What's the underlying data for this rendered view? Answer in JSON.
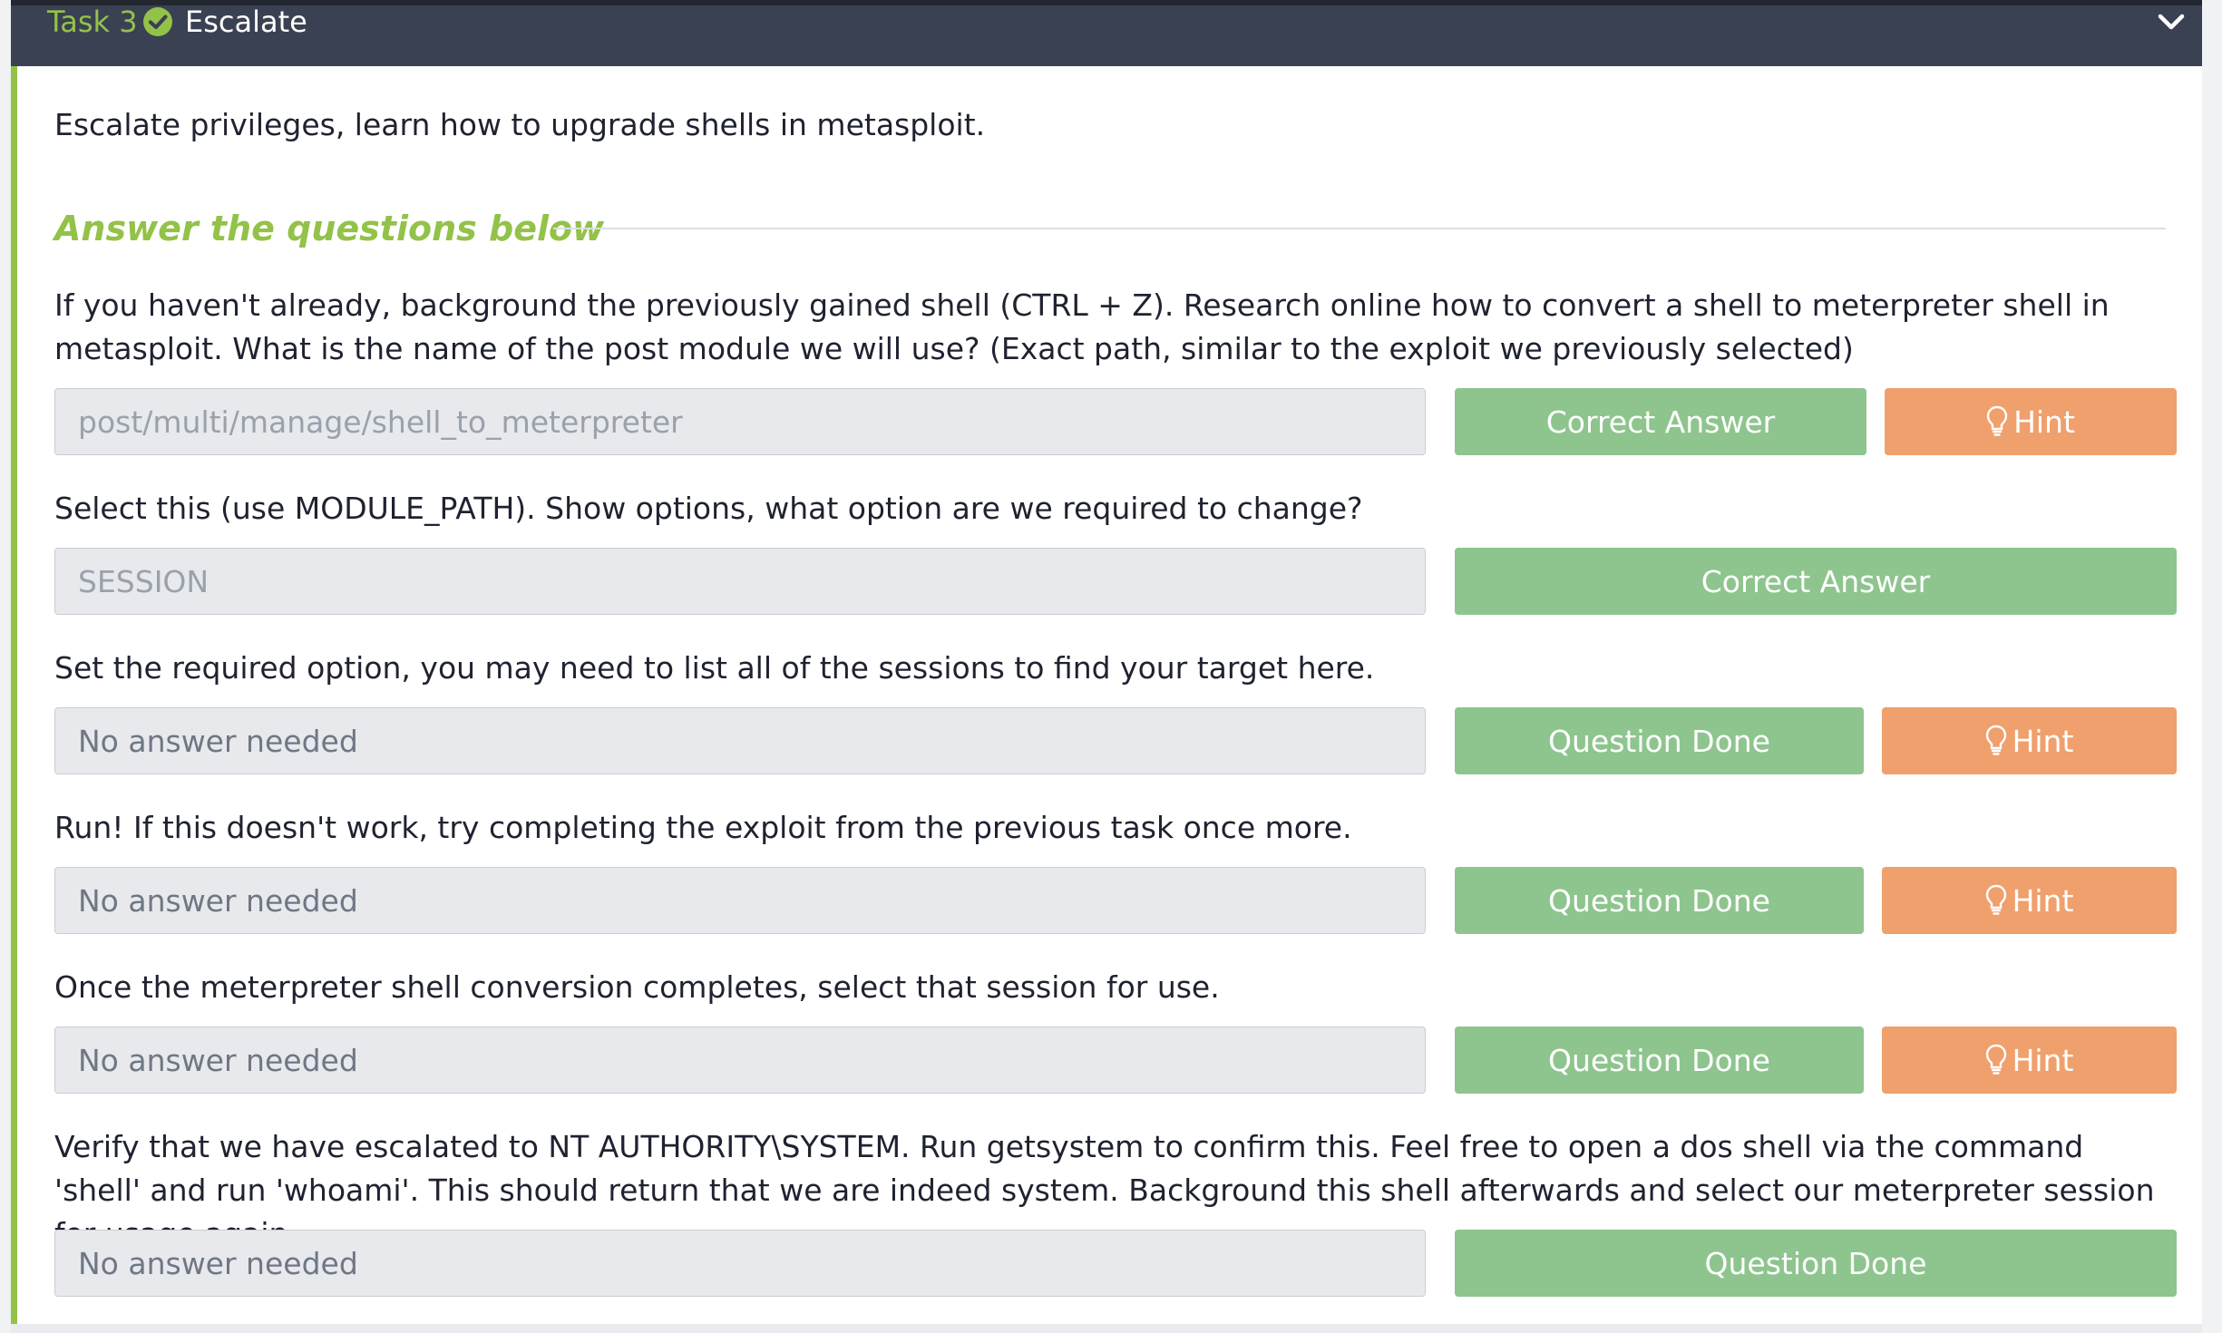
{
  "task": {
    "label": "Task 3",
    "title": "Escalate",
    "status_icon": "check-circle-icon",
    "toggle_icon": "chevron-down-icon"
  },
  "intro": "Escalate privileges, learn how to upgrade shells in metasploit.",
  "section_heading": "Answer the questions below",
  "questions": [
    {
      "text": "If you haven't already, background the previously gained shell (CTRL + Z). Research online how to convert a shell to meterpreter shell in metasploit. What is the name of the post module we will use? (Exact path, similar to the exploit we previously selected)",
      "answer": "post/multi/manage/shell_to_meterpreter",
      "primary_label": "Correct Answer",
      "hint_label": "Hint"
    },
    {
      "text": "Select this (use MODULE_PATH). Show options, what option are we required to change?",
      "answer": "SESSION",
      "primary_label": "Correct Answer"
    },
    {
      "text": "Set the required option, you may need to list all of the sessions to find your target here.",
      "answer": "No answer needed",
      "primary_label": "Question Done",
      "hint_label": "Hint"
    },
    {
      "text": "Run! If this doesn't work, try completing the exploit from the previous task once more.",
      "answer": "No answer needed",
      "primary_label": "Question Done",
      "hint_label": "Hint"
    },
    {
      "text": "Once the meterpreter shell conversion completes, select that session for use.",
      "answer": "No answer needed",
      "primary_label": "Question Done",
      "hint_label": "Hint"
    },
    {
      "text": "Verify that we have escalated to NT AUTHORITY\\SYSTEM. Run getsystem to confirm this. Feel free to open a dos shell via the command 'shell' and run 'whoami'. This should return that we are indeed system. Background this shell afterwards and select our meterpreter session for usage again.",
      "answer": "No answer needed",
      "primary_label": "Question Done"
    }
  ],
  "colors": {
    "header_bg": "#3a4152",
    "accent_green": "#93c248",
    "button_green": "#8ec58e",
    "button_orange": "#f0a06c",
    "input_bg": "#e7e9ed"
  }
}
